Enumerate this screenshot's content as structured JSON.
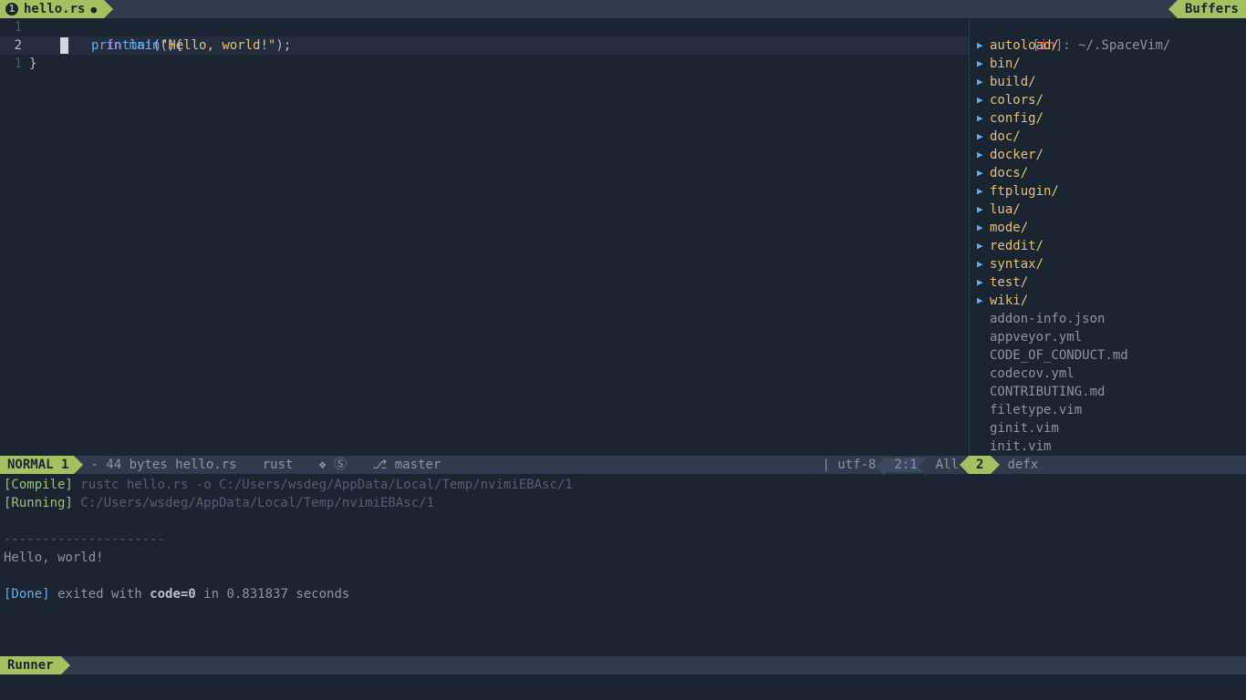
{
  "tab": {
    "index": "1",
    "filename": "hello.rs",
    "close": "●"
  },
  "buffers_label": "Buffers",
  "code": {
    "lines": [
      {
        "num": "1",
        "fn": "fn",
        "name": "main",
        "rest": "(){",
        "hl": false
      },
      {
        "num": "2",
        "indent": "    ",
        "macro": "println!",
        "open": "(",
        "string": "\"Hello, world!\"",
        "close": ");",
        "hl": true,
        "cursor": true
      },
      {
        "num": "1",
        "brace": "}",
        "hl": false
      }
    ]
  },
  "sidebar": {
    "in_label": "[in]",
    "path": ": ~/.SpaceVim/",
    "dirs": [
      "autoload/",
      "bin/",
      "build/",
      "colors/",
      "config/",
      "doc/",
      "docker/",
      "docs/",
      "ftplugin/",
      "lua/",
      "mode/",
      "reddit/",
      "syntax/",
      "test/",
      "wiki/"
    ],
    "files": [
      "addon-info.json",
      "appveyor.yml",
      "CODE_OF_CONDUCT.md",
      "codecov.yml",
      "CONTRIBUTING.md",
      "filetype.vim",
      "ginit.vim",
      "init.vim"
    ]
  },
  "statusline": {
    "mode": "NORMAL 1",
    "fileinfo": "- 44 bytes hello.rs",
    "filetype": "rust",
    "ext": "❖ Ⓢ",
    "branch_icon": "⎇",
    "branch": "master",
    "os_icon": "",
    "pipe": " | ",
    "enc": "utf-8",
    "pos": "2:1",
    "pct": "All",
    "side_idx": "2",
    "side_name": "defx"
  },
  "runner": {
    "compile_tag": "[Compile]",
    "compile_cmd": " rustc hello.rs -o C:/Users/wsdeg/AppData/Local/Temp/nvimiEBAsc/1",
    "running_tag": "[Running]",
    "running_cmd": " C:/Users/wsdeg/AppData/Local/Temp/nvimiEBAsc/1",
    "sep": "---------------------",
    "output": "Hello, world!",
    "done_tag": "[Done]",
    "done_pre": " exited with ",
    "done_code": "code=0",
    "done_post": " in 0.831837 seconds",
    "label": "Runner"
  }
}
